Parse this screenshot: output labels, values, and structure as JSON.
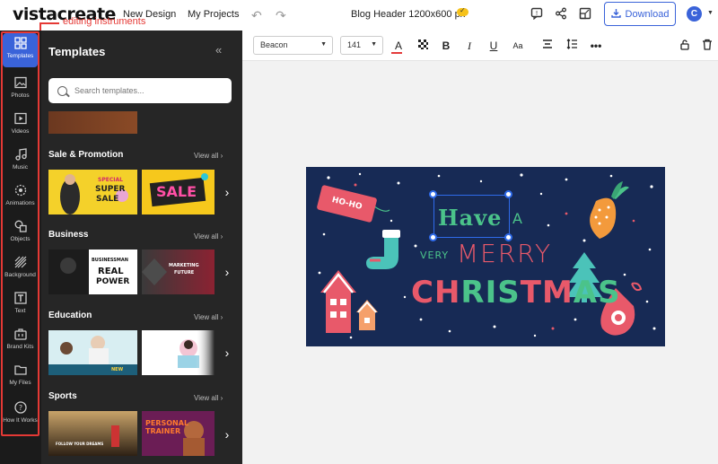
{
  "topbar": {
    "logo": "vistacreate",
    "annotation": "editing instruments",
    "nav_new_design": "New Design",
    "nav_my_projects": "My Projects",
    "document_title": "Blog Header 1200x600 px",
    "download_label": "Download",
    "avatar_initial": "C"
  },
  "sidebar": {
    "items": [
      {
        "label": "Templates",
        "icon": "templates-icon"
      },
      {
        "label": "Photos",
        "icon": "photos-icon"
      },
      {
        "label": "Videos",
        "icon": "videos-icon"
      },
      {
        "label": "Music",
        "icon": "music-icon"
      },
      {
        "label": "Animations",
        "icon": "animations-icon"
      },
      {
        "label": "Objects",
        "icon": "objects-icon"
      },
      {
        "label": "Background",
        "icon": "background-icon"
      },
      {
        "label": "Text",
        "icon": "text-icon"
      },
      {
        "label": "Brand Kits",
        "icon": "brand-kits-icon"
      },
      {
        "label": "My Files",
        "icon": "folder-icon"
      },
      {
        "label": "How It Works",
        "icon": "help-icon"
      }
    ]
  },
  "panel": {
    "title": "Templates",
    "search_placeholder": "Search templates...",
    "sections": [
      {
        "title": "Sale & Promotion",
        "view_all": "View all"
      },
      {
        "title": "Business",
        "view_all": "View all"
      },
      {
        "title": "Education",
        "view_all": "View all"
      },
      {
        "title": "Sports",
        "view_all": "View all"
      }
    ],
    "thumb_texts": {
      "special": "SPECIAL",
      "super": "SUPER",
      "sale_small": "SALE",
      "sale_big": "SALE",
      "businessman": "BUSINESSMAN",
      "real": "REAL",
      "power": "POWER",
      "marketing": "MARKETING",
      "future": "FUTURE",
      "new": "NEW",
      "personal_trainer": "PERSONAL TRAINER",
      "sports_follow": "FOLLOW YOUR DREAMS"
    }
  },
  "text_toolbar": {
    "font": "Beacon",
    "size": "141",
    "text_color": "#e43b3b"
  },
  "banner": {
    "hoho": "HO-HO",
    "have": "Have",
    "a": "A",
    "very": "VERY",
    "merry": "MERRY",
    "christmas": "CHRISTMAS",
    "background_color": "#172a55"
  }
}
